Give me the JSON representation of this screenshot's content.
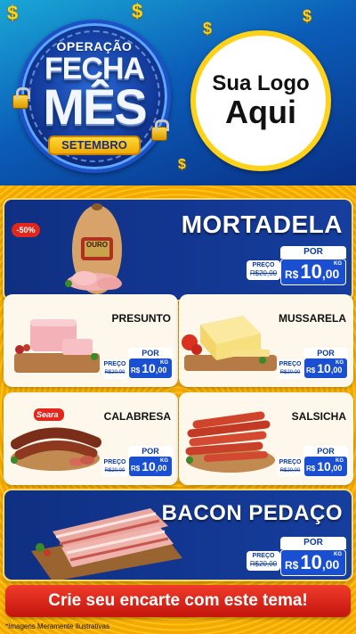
{
  "hero": {
    "badge": {
      "line1": "OPERAÇÃO",
      "line2": "FECHA",
      "line3": "MÊS",
      "ribbon": "SETEMBRO"
    },
    "logo": {
      "line1": "Sua Logo",
      "line2": "Aqui"
    },
    "dollar_glyph": "$"
  },
  "products": {
    "mortadela": {
      "name": "MORTADELA",
      "discount": "-50%",
      "brand": "OURO",
      "por": "POR",
      "preco": "PREÇO",
      "old": "R$20,00",
      "currency": "R$",
      "int": "10",
      "cents": ",00",
      "unit": "KG"
    },
    "presunto": {
      "name": "PRESUNTO",
      "por": "POR",
      "preco": "PREÇO",
      "old": "R$20,00",
      "currency": "R$",
      "int": "10",
      "cents": ",00",
      "unit": "KG"
    },
    "mussarela": {
      "name": "MUSSARELA",
      "por": "POR",
      "preco": "PREÇO",
      "old": "R$20,00",
      "currency": "R$",
      "int": "10",
      "cents": ",00",
      "unit": "KG"
    },
    "calabresa": {
      "name": "CALABRESA",
      "brand": "Seara",
      "por": "POR",
      "preco": "PREÇO",
      "old": "R$20,00",
      "currency": "R$",
      "int": "10",
      "cents": ",00",
      "unit": "KG"
    },
    "salsicha": {
      "name": "SALSICHA",
      "por": "POR",
      "preco": "PREÇO",
      "old": "R$20,00",
      "currency": "R$",
      "int": "10",
      "cents": ",00",
      "unit": "KG"
    },
    "bacon": {
      "name": "BACON PEDAÇO",
      "por": "POR",
      "preco": "PREÇO",
      "old": "R$20,00",
      "currency": "R$",
      "int": "10",
      "cents": ",00",
      "unit": "KG"
    }
  },
  "cta": "Crie seu encarte com este tema!",
  "footnote": "*Imagens Meramente Ilustrativas",
  "colors": {
    "blue": "#0f2f82",
    "yellow": "#ffc21a",
    "red": "#e1261c"
  }
}
